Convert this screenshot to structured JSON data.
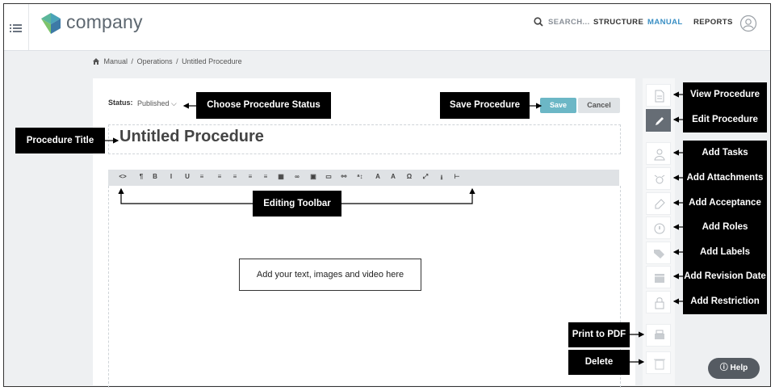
{
  "brand": "company",
  "nav": {
    "search": "SEARCH...",
    "structure": "STRUCTURE",
    "manual": "MANUAL",
    "reports": "REPORTS"
  },
  "breadcrumb": [
    "Manual",
    "Operations",
    "Untitled Procedure"
  ],
  "status": {
    "label": "Status:",
    "value": "Published"
  },
  "buttons": {
    "save": "Save",
    "cancel": "Cancel"
  },
  "procedure_title": "Untitled Procedure",
  "toolbar_icons": [
    "code-view",
    "paragraph",
    "bold",
    "italic",
    "underline",
    "unordered-list",
    "ordered-list",
    "outdent",
    "indent",
    "align",
    "table",
    "link",
    "image",
    "video",
    "hyperlink",
    "formatting",
    "text-color",
    "background-color",
    "omega",
    "fullscreen",
    "download",
    "horizontal-rule"
  ],
  "toolbar_glyphs": [
    "<>",
    "¶",
    "B",
    "I",
    "U",
    "≡",
    "≡",
    "≡",
    "≡",
    "≡",
    "▦",
    "∞",
    "▣",
    "▭",
    "⚯",
    "ᵃ↕",
    "A",
    "A",
    "Ω",
    "⤢",
    "⭳",
    "⊢"
  ],
  "right_rail": [
    "view-procedure",
    "edit-procedure",
    "add-tasks",
    "add-attachments",
    "add-acceptance",
    "add-roles",
    "add-labels",
    "add-revision-date",
    "add-restriction",
    "print-to-pdf",
    "delete"
  ],
  "annotations": {
    "choose_status": "Choose Procedure Status",
    "save_procedure": "Save Procedure",
    "procedure_title": "Procedure Title",
    "editing_toolbar": "Editing Toolbar",
    "editor_hint": "Add your text, images and video here",
    "view_procedure": "View Procedure",
    "edit_procedure": "Edit Procedure",
    "add_tasks": "Add Tasks",
    "add_attachments": "Add Attachments",
    "add_acceptance": "Add Acceptance",
    "add_roles": "Add Roles",
    "add_labels": "Add Labels",
    "add_revision_date": "Add Revision Date",
    "add_restriction": "Add Restriction",
    "print_pdf": "Print to PDF",
    "delete": "Delete"
  },
  "help": "Help",
  "colors": {
    "accent": "#3a8fc4",
    "save": "#6cb7c6",
    "rail_active": "#666d75"
  }
}
